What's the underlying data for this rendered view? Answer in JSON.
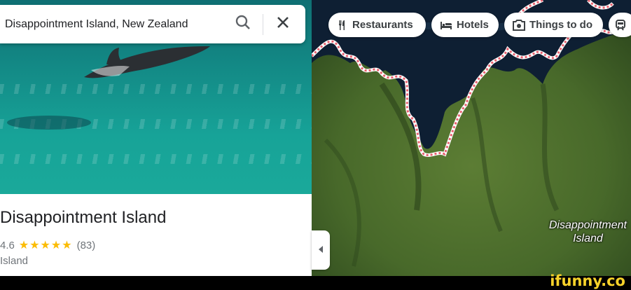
{
  "search": {
    "query": "Disappointment Island, New Zealand"
  },
  "place": {
    "name": "Disappointment Island",
    "rating": "4.6",
    "stars": "★★★★★",
    "review_count": "(83)",
    "type": "Island"
  },
  "chips": [
    {
      "label": "Restaurants",
      "icon": "restaurant-icon"
    },
    {
      "label": "Hotels",
      "icon": "hotel-icon"
    },
    {
      "label": "Things to do",
      "icon": "camera-icon"
    },
    {
      "label": "",
      "icon": "transit-icon"
    }
  ],
  "map": {
    "label_line1": "Disappointment",
    "label_line2": "Island"
  },
  "watermark": "ifunny.co",
  "colors": {
    "star": "#fbbc04",
    "boundary": "#e8606e",
    "land": "#4a6b2c",
    "sea": "#0e1f33"
  }
}
